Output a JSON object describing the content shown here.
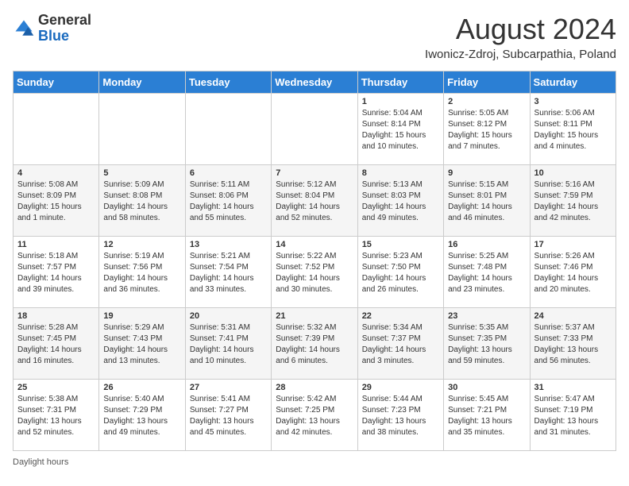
{
  "header": {
    "logo": {
      "general": "General",
      "blue": "Blue"
    },
    "title": "August 2024",
    "location": "Iwonicz-Zdroj, Subcarpathia, Poland"
  },
  "columns": [
    "Sunday",
    "Monday",
    "Tuesday",
    "Wednesday",
    "Thursday",
    "Friday",
    "Saturday"
  ],
  "weeks": [
    [
      {
        "day": "",
        "info": ""
      },
      {
        "day": "",
        "info": ""
      },
      {
        "day": "",
        "info": ""
      },
      {
        "day": "",
        "info": ""
      },
      {
        "day": "1",
        "info": "Sunrise: 5:04 AM\nSunset: 8:14 PM\nDaylight: 15 hours\nand 10 minutes."
      },
      {
        "day": "2",
        "info": "Sunrise: 5:05 AM\nSunset: 8:12 PM\nDaylight: 15 hours\nand 7 minutes."
      },
      {
        "day": "3",
        "info": "Sunrise: 5:06 AM\nSunset: 8:11 PM\nDaylight: 15 hours\nand 4 minutes."
      }
    ],
    [
      {
        "day": "4",
        "info": "Sunrise: 5:08 AM\nSunset: 8:09 PM\nDaylight: 15 hours\nand 1 minute."
      },
      {
        "day": "5",
        "info": "Sunrise: 5:09 AM\nSunset: 8:08 PM\nDaylight: 14 hours\nand 58 minutes."
      },
      {
        "day": "6",
        "info": "Sunrise: 5:11 AM\nSunset: 8:06 PM\nDaylight: 14 hours\nand 55 minutes."
      },
      {
        "day": "7",
        "info": "Sunrise: 5:12 AM\nSunset: 8:04 PM\nDaylight: 14 hours\nand 52 minutes."
      },
      {
        "day": "8",
        "info": "Sunrise: 5:13 AM\nSunset: 8:03 PM\nDaylight: 14 hours\nand 49 minutes."
      },
      {
        "day": "9",
        "info": "Sunrise: 5:15 AM\nSunset: 8:01 PM\nDaylight: 14 hours\nand 46 minutes."
      },
      {
        "day": "10",
        "info": "Sunrise: 5:16 AM\nSunset: 7:59 PM\nDaylight: 14 hours\nand 42 minutes."
      }
    ],
    [
      {
        "day": "11",
        "info": "Sunrise: 5:18 AM\nSunset: 7:57 PM\nDaylight: 14 hours\nand 39 minutes."
      },
      {
        "day": "12",
        "info": "Sunrise: 5:19 AM\nSunset: 7:56 PM\nDaylight: 14 hours\nand 36 minutes."
      },
      {
        "day": "13",
        "info": "Sunrise: 5:21 AM\nSunset: 7:54 PM\nDaylight: 14 hours\nand 33 minutes."
      },
      {
        "day": "14",
        "info": "Sunrise: 5:22 AM\nSunset: 7:52 PM\nDaylight: 14 hours\nand 30 minutes."
      },
      {
        "day": "15",
        "info": "Sunrise: 5:23 AM\nSunset: 7:50 PM\nDaylight: 14 hours\nand 26 minutes."
      },
      {
        "day": "16",
        "info": "Sunrise: 5:25 AM\nSunset: 7:48 PM\nDaylight: 14 hours\nand 23 minutes."
      },
      {
        "day": "17",
        "info": "Sunrise: 5:26 AM\nSunset: 7:46 PM\nDaylight: 14 hours\nand 20 minutes."
      }
    ],
    [
      {
        "day": "18",
        "info": "Sunrise: 5:28 AM\nSunset: 7:45 PM\nDaylight: 14 hours\nand 16 minutes."
      },
      {
        "day": "19",
        "info": "Sunrise: 5:29 AM\nSunset: 7:43 PM\nDaylight: 14 hours\nand 13 minutes."
      },
      {
        "day": "20",
        "info": "Sunrise: 5:31 AM\nSunset: 7:41 PM\nDaylight: 14 hours\nand 10 minutes."
      },
      {
        "day": "21",
        "info": "Sunrise: 5:32 AM\nSunset: 7:39 PM\nDaylight: 14 hours\nand 6 minutes."
      },
      {
        "day": "22",
        "info": "Sunrise: 5:34 AM\nSunset: 7:37 PM\nDaylight: 14 hours\nand 3 minutes."
      },
      {
        "day": "23",
        "info": "Sunrise: 5:35 AM\nSunset: 7:35 PM\nDaylight: 13 hours\nand 59 minutes."
      },
      {
        "day": "24",
        "info": "Sunrise: 5:37 AM\nSunset: 7:33 PM\nDaylight: 13 hours\nand 56 minutes."
      }
    ],
    [
      {
        "day": "25",
        "info": "Sunrise: 5:38 AM\nSunset: 7:31 PM\nDaylight: 13 hours\nand 52 minutes."
      },
      {
        "day": "26",
        "info": "Sunrise: 5:40 AM\nSunset: 7:29 PM\nDaylight: 13 hours\nand 49 minutes."
      },
      {
        "day": "27",
        "info": "Sunrise: 5:41 AM\nSunset: 7:27 PM\nDaylight: 13 hours\nand 45 minutes."
      },
      {
        "day": "28",
        "info": "Sunrise: 5:42 AM\nSunset: 7:25 PM\nDaylight: 13 hours\nand 42 minutes."
      },
      {
        "day": "29",
        "info": "Sunrise: 5:44 AM\nSunset: 7:23 PM\nDaylight: 13 hours\nand 38 minutes."
      },
      {
        "day": "30",
        "info": "Sunrise: 5:45 AM\nSunset: 7:21 PM\nDaylight: 13 hours\nand 35 minutes."
      },
      {
        "day": "31",
        "info": "Sunrise: 5:47 AM\nSunset: 7:19 PM\nDaylight: 13 hours\nand 31 minutes."
      }
    ]
  ],
  "footer": {
    "daylight_label": "Daylight hours"
  }
}
